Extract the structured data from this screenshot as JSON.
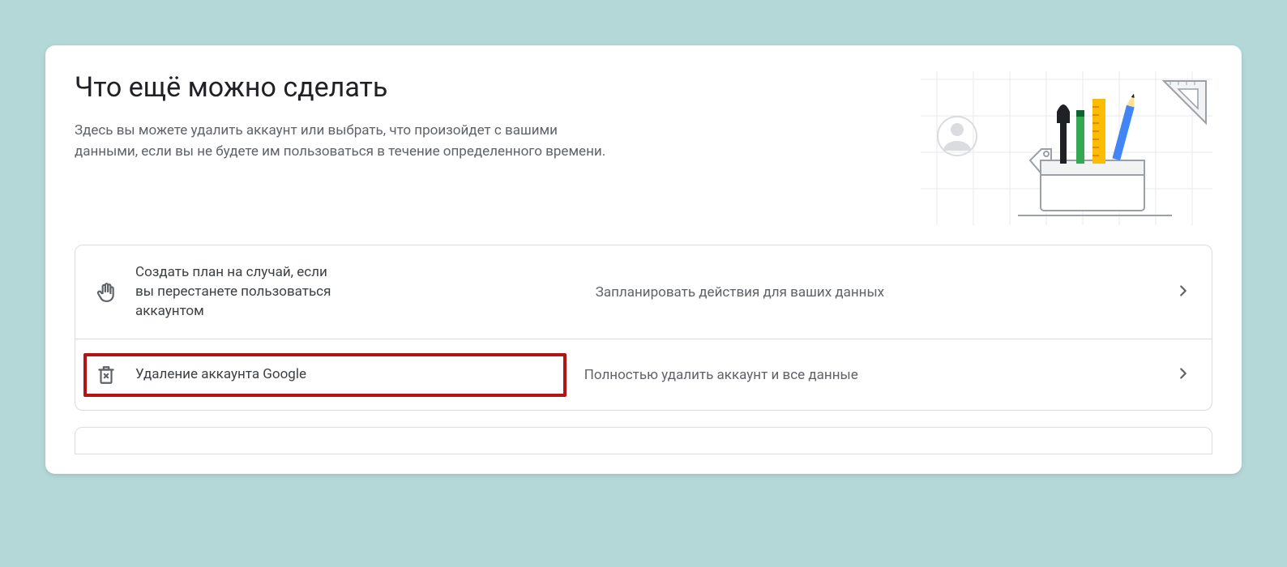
{
  "header": {
    "title": "Что ещё можно сделать",
    "subtitle": "Здесь вы можете удалить аккаунт или выбрать, что произойдет с вашими данными, если вы не будете им пользоваться в течение определенного времени."
  },
  "rows": [
    {
      "icon": "hand-icon",
      "label": "Создать план на случай, если вы перестанете пользоваться аккаунтом",
      "desc": "Запланировать действия для ваших данных",
      "highlight": false
    },
    {
      "icon": "trash-icon",
      "label": "Удаление аккаунта Google",
      "desc": "Полностью удалить аккаунт и все данные",
      "highlight": true
    }
  ]
}
